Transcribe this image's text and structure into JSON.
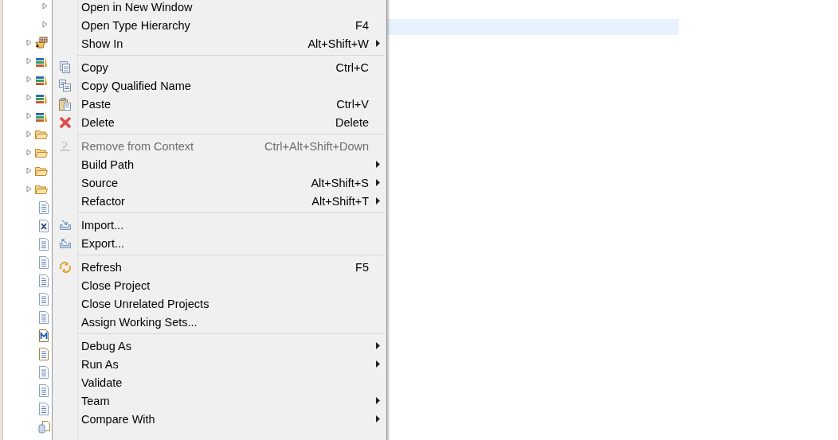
{
  "tree": [
    {
      "kind": "sub-node"
    },
    {
      "kind": "sub-node"
    },
    {
      "kind": "jar-package"
    },
    {
      "kind": "library"
    },
    {
      "kind": "library"
    },
    {
      "kind": "library"
    },
    {
      "kind": "library"
    },
    {
      "kind": "folder"
    },
    {
      "kind": "folder"
    },
    {
      "kind": "folder"
    },
    {
      "kind": "folder"
    },
    {
      "kind": "file"
    },
    {
      "kind": "xml-file"
    },
    {
      "kind": "file"
    },
    {
      "kind": "file"
    },
    {
      "kind": "file"
    },
    {
      "kind": "file"
    },
    {
      "kind": "file"
    },
    {
      "kind": "manifest-file"
    },
    {
      "kind": "text-file"
    },
    {
      "kind": "file"
    },
    {
      "kind": "file"
    },
    {
      "kind": "file"
    },
    {
      "kind": "archive"
    }
  ],
  "menu": {
    "groups": [
      [
        {
          "label": "Open in New Window",
          "disabled": false,
          "submenu": false
        },
        {
          "label": "Open Type Hierarchy",
          "shortcut": "F4",
          "disabled": false,
          "submenu": false
        },
        {
          "label": "Show In",
          "shortcut": "Alt+Shift+W",
          "disabled": false,
          "submenu": true
        }
      ],
      [
        {
          "label": "Copy",
          "shortcut": "Ctrl+C",
          "kind": "copy",
          "disabled": false,
          "submenu": false
        },
        {
          "label": "Copy Qualified Name",
          "kind": "copy-qualified",
          "disabled": false,
          "submenu": false
        },
        {
          "label": "Paste",
          "shortcut": "Ctrl+V",
          "kind": "paste",
          "disabled": false,
          "submenu": false
        },
        {
          "label": "Delete",
          "shortcut": "Delete",
          "kind": "delete",
          "disabled": false,
          "submenu": false
        }
      ],
      [
        {
          "label": "Remove from Context",
          "shortcut": "Ctrl+Alt+Shift+Down",
          "kind": "remove-context",
          "disabled": true,
          "submenu": false
        },
        {
          "label": "Build Path",
          "disabled": false,
          "submenu": true
        },
        {
          "label": "Source",
          "shortcut": "Alt+Shift+S",
          "disabled": false,
          "submenu": true
        },
        {
          "label": "Refactor",
          "shortcut": "Alt+Shift+T",
          "disabled": false,
          "submenu": true
        }
      ],
      [
        {
          "label": "Import...",
          "kind": "import",
          "disabled": false,
          "submenu": false
        },
        {
          "label": "Export...",
          "kind": "export",
          "disabled": false,
          "submenu": false
        }
      ],
      [
        {
          "label": "Refresh",
          "shortcut": "F5",
          "kind": "refresh",
          "disabled": false,
          "submenu": false
        },
        {
          "label": "Close Project",
          "disabled": false,
          "submenu": false
        },
        {
          "label": "Close Unrelated Projects",
          "disabled": false,
          "submenu": false
        },
        {
          "label": "Assign Working Sets...",
          "disabled": false,
          "submenu": false
        }
      ],
      [
        {
          "label": "Debug As",
          "disabled": false,
          "submenu": true
        },
        {
          "label": "Run As",
          "disabled": false,
          "submenu": true
        },
        {
          "label": "Validate",
          "disabled": false,
          "submenu": false
        },
        {
          "label": "Team",
          "disabled": false,
          "submenu": true
        },
        {
          "label": "Compare With",
          "disabled": false,
          "submenu": true
        }
      ]
    ]
  }
}
